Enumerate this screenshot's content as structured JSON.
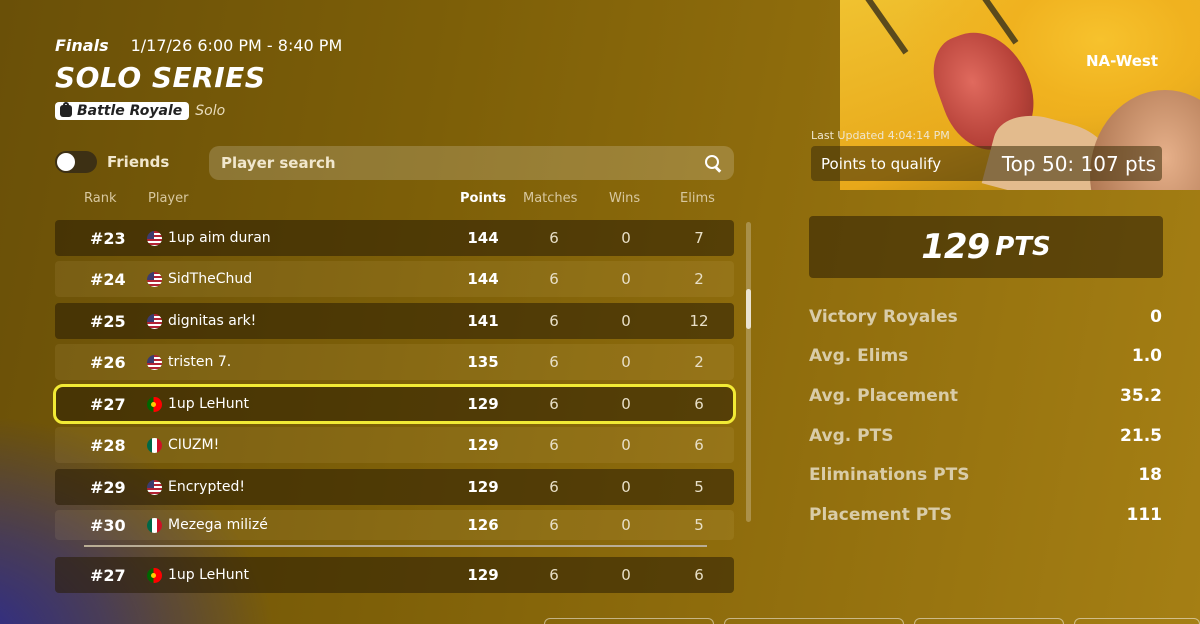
{
  "event": {
    "stage": "Finals",
    "datetime": "1/17/26 6:00 PM - 8:40 PM",
    "title": "SOLO SERIES",
    "mode_badge": "Battle Royale",
    "mode_sub": "Solo",
    "region": "NA-West"
  },
  "filters": {
    "friends_label": "Friends",
    "friends_toggle_on": false,
    "search_placeholder": "Player search"
  },
  "table": {
    "columns": [
      "Rank",
      "Player",
      "Points",
      "Matches",
      "Wins",
      "Elims"
    ],
    "rows": [
      {
        "rank": "#23",
        "flag": "us",
        "player": "1up aim duran",
        "points": "144",
        "matches": "6",
        "wins": "0",
        "elims": "7"
      },
      {
        "rank": "#24",
        "flag": "us",
        "player": "SidTheChud",
        "points": "144",
        "matches": "6",
        "wins": "0",
        "elims": "2"
      },
      {
        "rank": "#25",
        "flag": "us",
        "player": "dignitas ark!",
        "points": "141",
        "matches": "6",
        "wins": "0",
        "elims": "12"
      },
      {
        "rank": "#26",
        "flag": "us",
        "player": "tristen 7.",
        "points": "135",
        "matches": "6",
        "wins": "0",
        "elims": "2"
      },
      {
        "rank": "#27",
        "flag": "pt",
        "player": "1up LeHunt",
        "points": "129",
        "matches": "6",
        "wins": "0",
        "elims": "6"
      },
      {
        "rank": "#28",
        "flag": "mx",
        "player": "CIUZM!",
        "points": "129",
        "matches": "6",
        "wins": "0",
        "elims": "6"
      },
      {
        "rank": "#29",
        "flag": "us",
        "player": "Encrypted!",
        "points": "129",
        "matches": "6",
        "wins": "0",
        "elims": "5"
      },
      {
        "rank": "#30",
        "flag": "mx",
        "player": "Mezega milizé",
        "points": "126",
        "matches": "6",
        "wins": "0",
        "elims": "5"
      }
    ],
    "pinned": {
      "rank": "#27",
      "flag": "pt",
      "player": "1up LeHunt",
      "points": "129",
      "matches": "6",
      "wins": "0",
      "elims": "6"
    }
  },
  "summary": {
    "last_updated": "Last Updated 4:04:14 PM",
    "qualify_label": "Points to qualify",
    "qualify_value": "Top 50: 107 pts",
    "total_points": "129",
    "total_unit": "PTS",
    "stats": [
      {
        "label": "Victory Royales",
        "value": "0"
      },
      {
        "label": "Avg. Elims",
        "value": "1.0"
      },
      {
        "label": "Avg. Placement",
        "value": "35.2"
      },
      {
        "label": "Avg. PTS",
        "value": "21.5"
      },
      {
        "label": "Eliminations PTS",
        "value": "18"
      },
      {
        "label": "Placement PTS",
        "value": "111"
      }
    ]
  },
  "colors": {
    "highlight_outline": "#f2ea35",
    "background": "#7d5f08",
    "accent_art": "#f0b21f"
  }
}
